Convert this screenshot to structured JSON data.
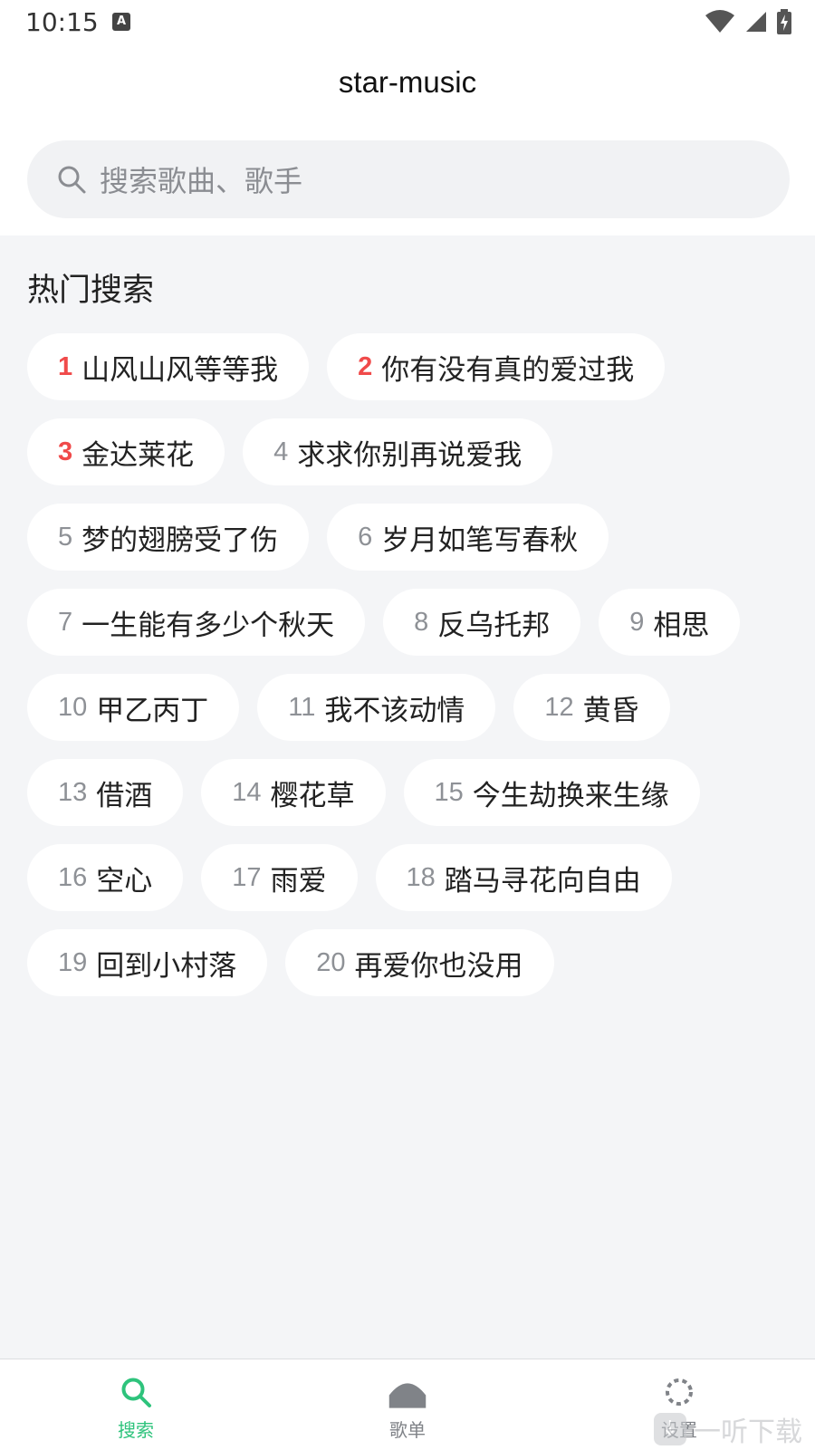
{
  "status_bar": {
    "time": "10:15",
    "notification_icon": "A"
  },
  "header": {
    "title": "star-music",
    "search": {
      "placeholder": "搜索歌曲、歌手"
    }
  },
  "hot_search": {
    "title": "热门搜索",
    "items": [
      {
        "rank": "1",
        "text": "山风山风等等我"
      },
      {
        "rank": "2",
        "text": "你有没有真的爱过我"
      },
      {
        "rank": "3",
        "text": "金达莱花"
      },
      {
        "rank": "4",
        "text": "求求你别再说爱我"
      },
      {
        "rank": "5",
        "text": "梦的翅膀受了伤"
      },
      {
        "rank": "6",
        "text": "岁月如笔写春秋"
      },
      {
        "rank": "7",
        "text": "一生能有多少个秋天"
      },
      {
        "rank": "8",
        "text": "反乌托邦"
      },
      {
        "rank": "9",
        "text": "相思"
      },
      {
        "rank": "10",
        "text": "甲乙丙丁"
      },
      {
        "rank": "11",
        "text": "我不该动情"
      },
      {
        "rank": "12",
        "text": "黄昏"
      },
      {
        "rank": "13",
        "text": "借酒"
      },
      {
        "rank": "14",
        "text": "樱花草"
      },
      {
        "rank": "15",
        "text": "今生劫换来生缘"
      },
      {
        "rank": "16",
        "text": "空心"
      },
      {
        "rank": "17",
        "text": "雨爱"
      },
      {
        "rank": "18",
        "text": "踏马寻花向自由"
      },
      {
        "rank": "19",
        "text": "回到小村落"
      },
      {
        "rank": "20",
        "text": "再爱你也没用"
      }
    ]
  },
  "tabbar": {
    "tabs": [
      {
        "label": "搜索",
        "icon": "search-icon",
        "active": true
      },
      {
        "label": "歌单",
        "icon": "playlist-icon",
        "active": false
      },
      {
        "label": "设置",
        "icon": "settings-icon",
        "active": false
      }
    ]
  },
  "watermark": {
    "text": "一听下载"
  },
  "colors": {
    "accent": "#2ec37c",
    "top_rank": "#f04a4a",
    "background": "#f4f5f7"
  }
}
